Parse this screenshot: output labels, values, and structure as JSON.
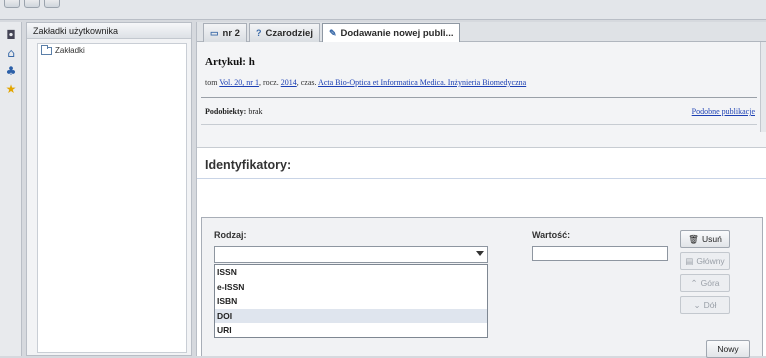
{
  "bookmarks": {
    "header": "Zakładki użytkownika",
    "tree_root": "Zakładki"
  },
  "tabs": [
    {
      "label": "nr 2",
      "icon": "page-icon"
    },
    {
      "label": "Czarodziej",
      "icon": "wizard-icon"
    },
    {
      "label": "Dodawanie nowej publi...",
      "icon": "edit-doc-icon",
      "active": true
    }
  ],
  "article": {
    "title": "Artykuł: h",
    "meta_prefix": "tom",
    "volume_link": "Vol. 20, nr 1",
    "year_prefix": ", rocz.",
    "year_link": "2014",
    "journal_prefix": ", czas.",
    "journal_link": "Acta Bio-Optica et Informatica Medica. Inżynieria Biomedyczna",
    "subobjects_label": "Podobiekty:",
    "subobjects_value": "brak",
    "similar_link": "Podobne publikacje"
  },
  "identifiers": {
    "title": "Identyfikatory:",
    "type_label": "Rodzaj:",
    "type_selected": "",
    "type_options": [
      "ISSN",
      "e-ISSN",
      "ISBN",
      "DOI",
      "URI"
    ],
    "type_highlighted": "DOI",
    "value_label": "Wartość:",
    "value": "",
    "buttons": {
      "delete": "Usuń",
      "main": "Główny",
      "up": "Góra",
      "down": "Dół",
      "new": "Nowy"
    }
  },
  "colors": {
    "link": "#1b3fb3",
    "selection": "#dfe5ee"
  }
}
